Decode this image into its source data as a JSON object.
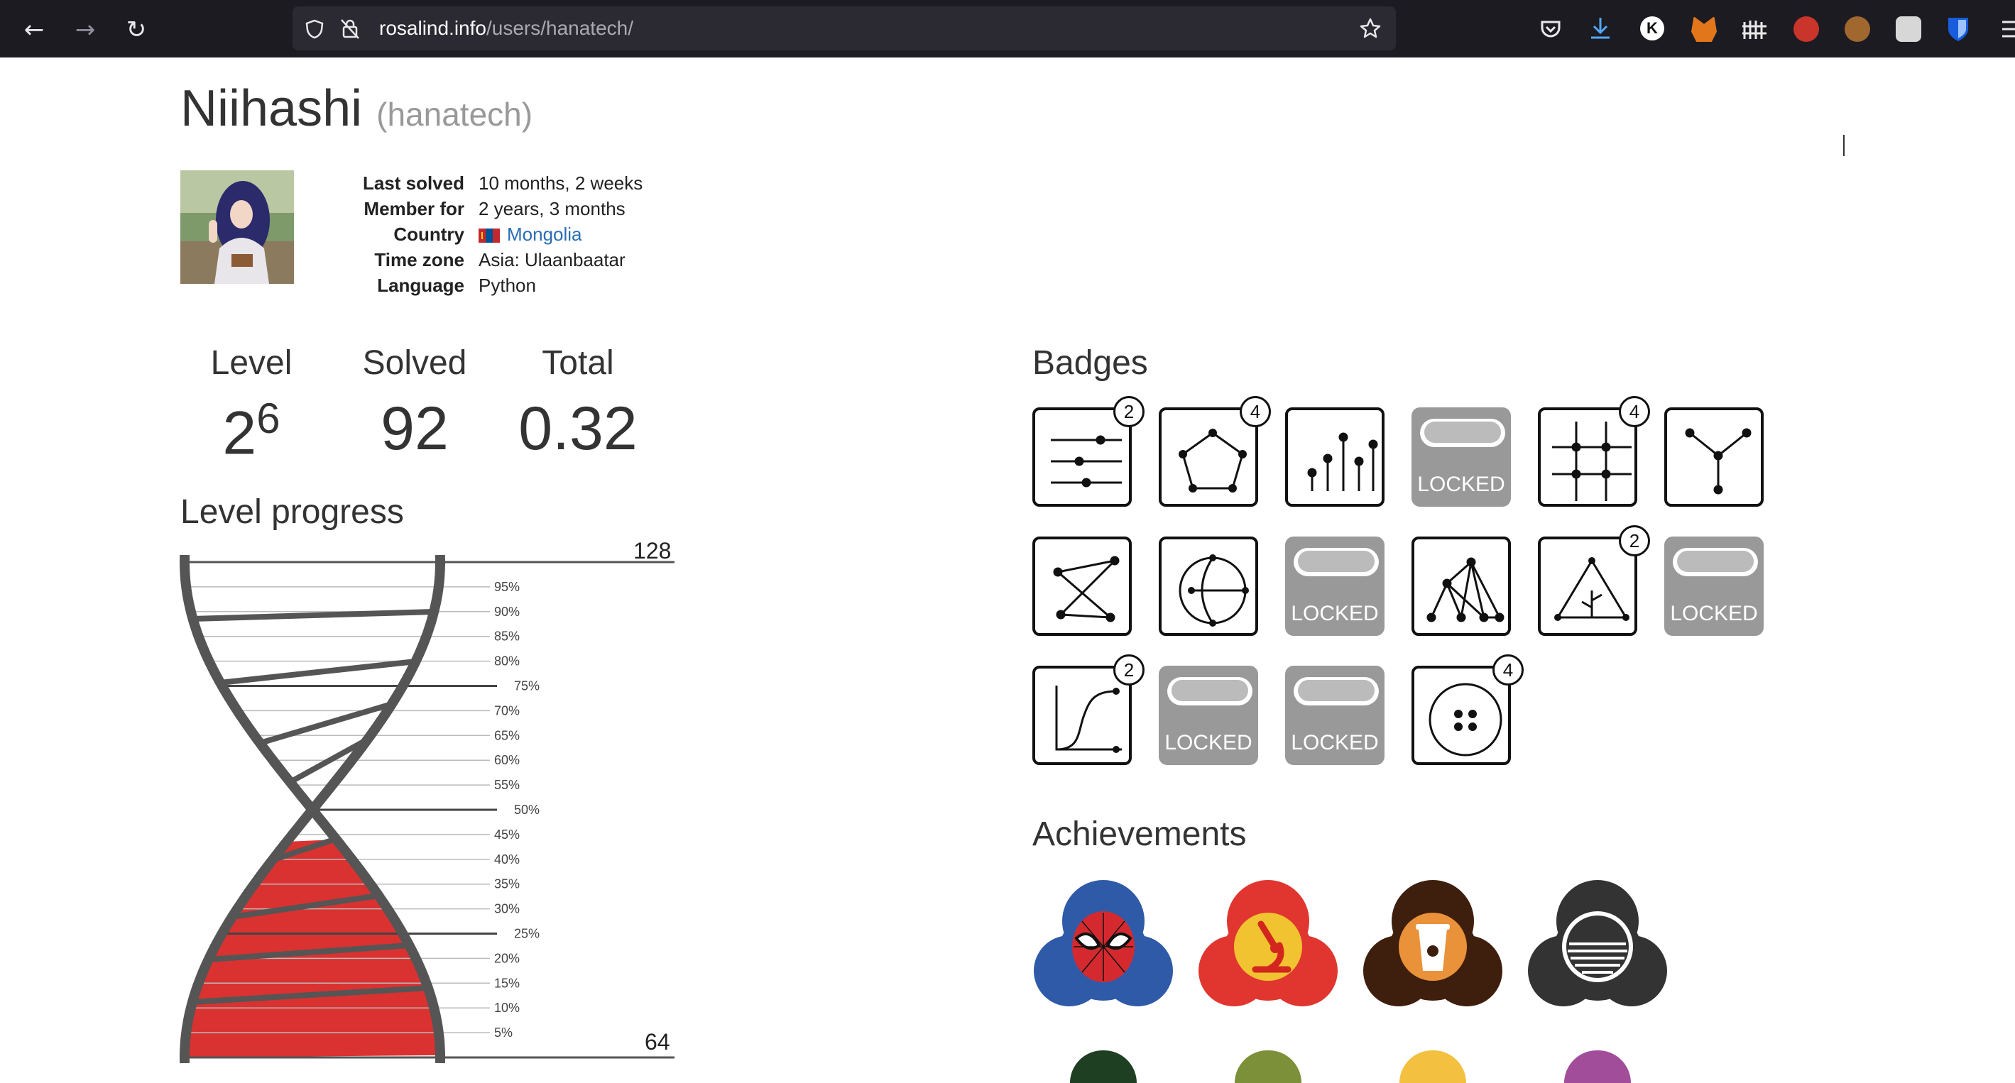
{
  "browser": {
    "url_host": "rosalind.info",
    "url_path": "/users/hanatech/"
  },
  "profile": {
    "name": "Niihashi",
    "handle": "(hanatech)",
    "info": [
      {
        "label": "Last solved",
        "value": "10 months, 2 weeks"
      },
      {
        "label": "Member for",
        "value": "2 years, 3 months"
      },
      {
        "label": "Country",
        "value": "Mongolia"
      },
      {
        "label": "Time zone",
        "value": "Asia: Ulaanbaatar"
      },
      {
        "label": "Language",
        "value": "Python"
      }
    ]
  },
  "stats": {
    "level_label": "Level",
    "level_base": "2",
    "level_exp": "6",
    "solved_label": "Solved",
    "solved_value": "92",
    "total_label": "Total",
    "total_value": "0.32"
  },
  "level_progress": {
    "title": "Level progress",
    "top_value": "128",
    "bottom_value": "64",
    "progress_fraction": 0.44,
    "ticks": [
      "95%",
      "90%",
      "85%",
      "80%",
      "75%",
      "70%",
      "65%",
      "60%",
      "55%",
      "50%",
      "45%",
      "40%",
      "35%",
      "30%",
      "25%",
      "20%",
      "15%",
      "10%",
      "5%"
    ],
    "fill_color": "#d93230"
  },
  "badges": {
    "title": "Badges",
    "locked_label": "LOCKED",
    "items": [
      {
        "icon": "sliders-icon",
        "locked": false,
        "count": "2"
      },
      {
        "icon": "pentagon-icon",
        "locked": false,
        "count": "4"
      },
      {
        "icon": "stems-icon",
        "locked": false,
        "count": ""
      },
      {
        "icon": "locked-icon",
        "locked": true,
        "count": ""
      },
      {
        "icon": "grid-icon",
        "locked": false,
        "count": "4"
      },
      {
        "icon": "fork-icon",
        "locked": false,
        "count": ""
      },
      {
        "icon": "crossed-graph-icon",
        "locked": false,
        "count": ""
      },
      {
        "icon": "circle-graph-icon",
        "locked": false,
        "count": ""
      },
      {
        "icon": "locked-icon",
        "locked": true,
        "count": ""
      },
      {
        "icon": "zigzag-graph-icon",
        "locked": false,
        "count": ""
      },
      {
        "icon": "triangle-tree-icon",
        "locked": false,
        "count": "2"
      },
      {
        "icon": "locked-icon",
        "locked": true,
        "count": ""
      },
      {
        "icon": "sigmoid-icon",
        "locked": false,
        "count": "2"
      },
      {
        "icon": "locked-icon",
        "locked": true,
        "count": ""
      },
      {
        "icon": "locked-icon",
        "locked": true,
        "count": ""
      },
      {
        "icon": "button-icon",
        "locked": false,
        "count": "4"
      }
    ]
  },
  "achievements": {
    "title": "Achievements",
    "items": [
      {
        "icon": "spiderman-icon",
        "color": "#2f5aa8"
      },
      {
        "icon": "microscope-icon",
        "color": "#e0362f"
      },
      {
        "icon": "coffee-icon",
        "color": "#3e1e0c"
      },
      {
        "icon": "striped-circle-icon",
        "color": "#333333"
      }
    ],
    "partial_colors": [
      "#1f3f22",
      "#7c8f39",
      "#f3c040",
      "#a24d9a"
    ]
  }
}
